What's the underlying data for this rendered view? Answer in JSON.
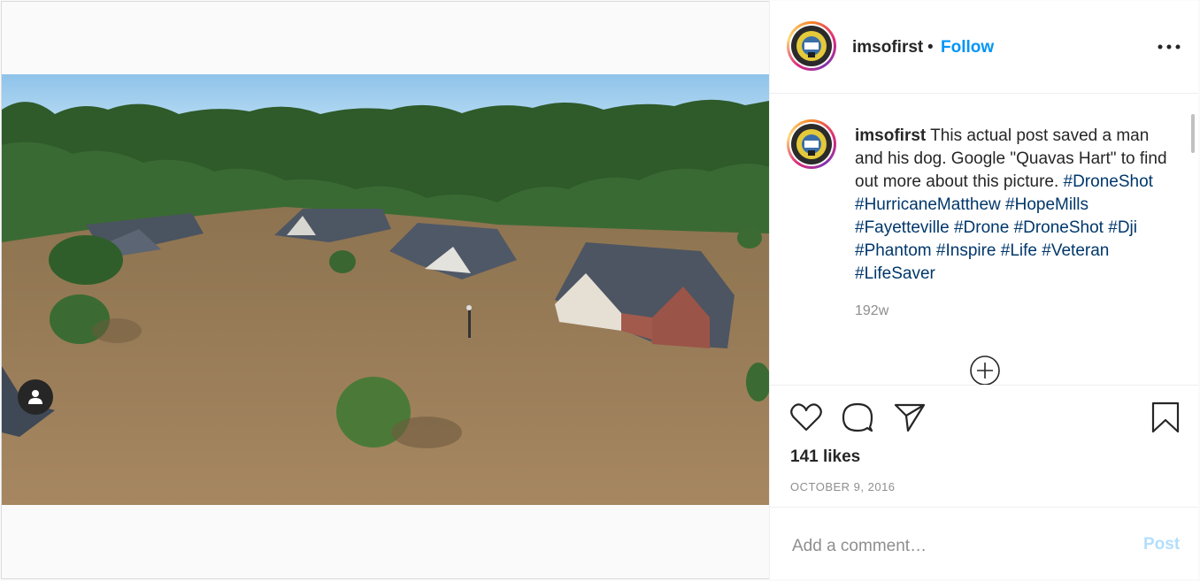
{
  "post": {
    "username": "imsofirst",
    "separator": "•",
    "follow_label": "Follow",
    "more_icon": "more-options-icon",
    "caption_user": "imsofirst",
    "caption_text": " This actual post saved a man and his dog. Google \"Quavas Hart\" to find out more about this picture. ",
    "hashtags": [
      "#DroneShot",
      "#HurricaneMatthew",
      "#HopeMills",
      "#Fayetteville",
      "#Drone",
      "#DroneShot",
      "#Dji",
      "#Phantom",
      "#Inspire",
      "#Life",
      "#Veteran",
      "#LifeSaver"
    ],
    "time_ago": "192w",
    "likes": "141 likes",
    "date": "OCTOBER 9, 2016"
  },
  "comment": {
    "placeholder": "Add a comment…",
    "post_label": "Post"
  },
  "colors": {
    "link": "#0095f6",
    "hashtag": "#00376b",
    "muted": "#8e8e8e"
  }
}
